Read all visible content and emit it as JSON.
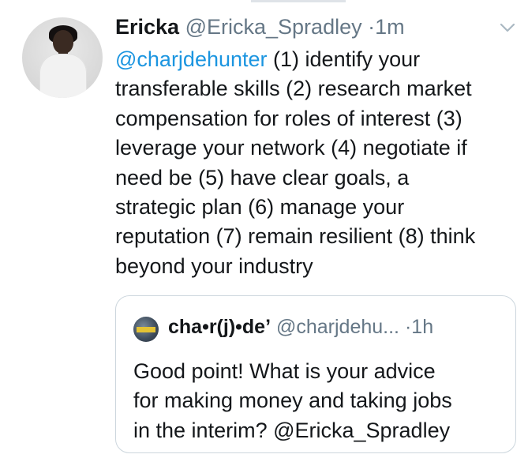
{
  "tweet": {
    "display_name": "Ericka",
    "handle": "@Ericka_Spradley",
    "separator": "·",
    "time": "1m",
    "body_mention": "@charjdehunter",
    "body_lines": [
      " (1) identify your",
      "transferable skills (2) research market",
      "compensation for roles of interest (3)",
      "leverage your network (4) negotiate if",
      "need be (5) have clear goals, a",
      "strategic plan (6) manage your",
      "reputation (7) remain resilient (8) think",
      "beyond your industry"
    ]
  },
  "quoted_tweet": {
    "display_name": "cha•r(j)•de’",
    "handle": "@charjdehu...",
    "separator": "·",
    "time": "1h",
    "body_lines": [
      "Good point! What is your advice",
      "for making money and taking jobs",
      "in the  interim? @Ericka_Spradley"
    ]
  },
  "icons": {
    "menu": "chevron-down-icon",
    "avatar": "profile-avatar",
    "quoted_avatar": "profile-avatar"
  },
  "colors": {
    "mention": "#1b95e0",
    "secondary_text": "#657786",
    "border": "#ccd6dd"
  }
}
